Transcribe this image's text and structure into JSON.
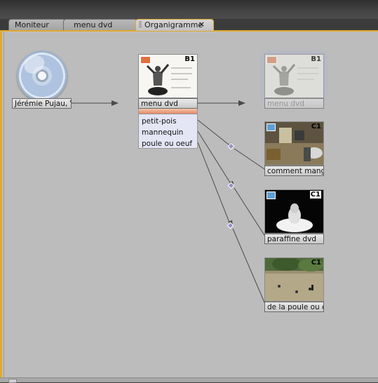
{
  "tabs": [
    {
      "label": "Moniteur"
    },
    {
      "label": "menu dvd"
    },
    {
      "label": "Organigramme",
      "close": "×"
    }
  ],
  "disc": {
    "label": "Jérémie Pujau, V"
  },
  "menu_node": {
    "label": "menu dvd",
    "badge": "B1",
    "buttons": [
      "petit-pois",
      "mannequin",
      "poule ou oeuf"
    ]
  },
  "ghost_node": {
    "label": "menu dvd",
    "badge": "B1"
  },
  "chapters": [
    {
      "label": "comment mange",
      "badge": "C1"
    },
    {
      "label": "paraffine dvd",
      "badge": "C1"
    },
    {
      "label": "de la poule ou d",
      "badge": "C1"
    }
  ],
  "colors": {
    "accent": "#e0a82e",
    "panel": "#bcbcbc",
    "link": "#4a4a4a"
  }
}
